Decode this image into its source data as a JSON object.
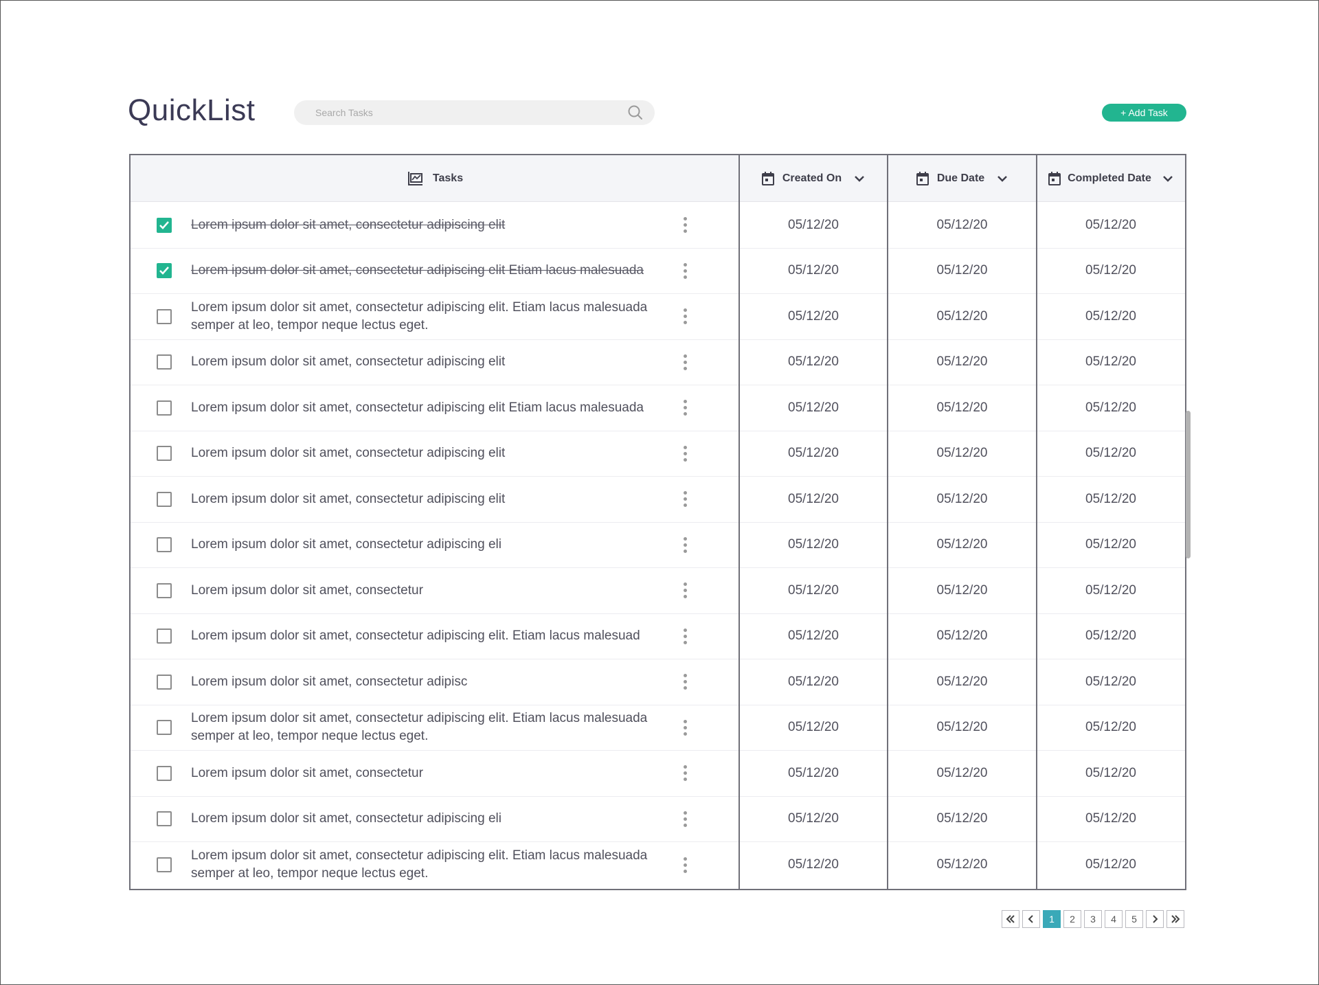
{
  "app": {
    "title": "QuickList"
  },
  "search": {
    "placeholder": "Search Tasks",
    "icon": "search-icon"
  },
  "toolbar": {
    "add_task_label": "+ Add Task"
  },
  "colors": {
    "accent": "#22b590",
    "pager_active": "#3aa9b8"
  },
  "table": {
    "headers": {
      "tasks": "Tasks",
      "created_on": "Created On",
      "due_date": "Due Date",
      "completed_date": "Completed Date"
    },
    "rows": [
      {
        "checked": true,
        "text": "Lorem ipsum dolor sit amet, consectetur adipiscing elit",
        "created": "05/12/20",
        "due": "05/12/20",
        "completed": "05/12/20"
      },
      {
        "checked": true,
        "text": "Lorem ipsum dolor sit amet, consectetur adipiscing elit Etiam lacus malesuada",
        "created": "05/12/20",
        "due": "05/12/20",
        "completed": "05/12/20"
      },
      {
        "checked": false,
        "text": "Lorem ipsum dolor sit amet, consectetur adipiscing elit. Etiam lacus malesuada semper at leo, tempor neque lectus eget.",
        "created": "05/12/20",
        "due": "05/12/20",
        "completed": "05/12/20"
      },
      {
        "checked": false,
        "text": "Lorem ipsum dolor sit amet, consectetur adipiscing elit",
        "created": "05/12/20",
        "due": "05/12/20",
        "completed": "05/12/20"
      },
      {
        "checked": false,
        "text": "Lorem ipsum dolor sit amet, consectetur adipiscing elit Etiam lacus malesuada",
        "created": "05/12/20",
        "due": "05/12/20",
        "completed": "05/12/20"
      },
      {
        "checked": false,
        "text": "Lorem ipsum dolor sit amet, consectetur adipiscing elit",
        "created": "05/12/20",
        "due": "05/12/20",
        "completed": "05/12/20"
      },
      {
        "checked": false,
        "text": "Lorem ipsum dolor sit amet, consectetur adipiscing elit",
        "created": "05/12/20",
        "due": "05/12/20",
        "completed": "05/12/20"
      },
      {
        "checked": false,
        "text": "Lorem ipsum dolor sit amet, consectetur adipiscing eli",
        "created": "05/12/20",
        "due": "05/12/20",
        "completed": "05/12/20"
      },
      {
        "checked": false,
        "text": "Lorem ipsum dolor sit amet, consectetur",
        "created": "05/12/20",
        "due": "05/12/20",
        "completed": "05/12/20"
      },
      {
        "checked": false,
        "text": "Lorem ipsum dolor sit amet, consectetur adipiscing elit. Etiam lacus malesuad",
        "created": "05/12/20",
        "due": "05/12/20",
        "completed": "05/12/20"
      },
      {
        "checked": false,
        "text": "Lorem ipsum dolor sit amet, consectetur adipisc",
        "created": "05/12/20",
        "due": "05/12/20",
        "completed": "05/12/20"
      },
      {
        "checked": false,
        "text": "Lorem ipsum dolor sit amet, consectetur adipiscing elit. Etiam lacus malesuada semper at leo, tempor neque lectus eget.",
        "created": "05/12/20",
        "due": "05/12/20",
        "completed": "05/12/20"
      },
      {
        "checked": false,
        "text": "Lorem ipsum dolor sit amet, consectetur",
        "created": "05/12/20",
        "due": "05/12/20",
        "completed": "05/12/20"
      },
      {
        "checked": false,
        "text": "Lorem ipsum dolor sit amet, consectetur adipiscing eli",
        "created": "05/12/20",
        "due": "05/12/20",
        "completed": "05/12/20"
      },
      {
        "checked": false,
        "text": "Lorem ipsum dolor sit amet, consectetur adipiscing elit. Etiam lacus malesuada semper at leo, tempor neque lectus eget.",
        "created": "05/12/20",
        "due": "05/12/20",
        "completed": "05/12/20"
      }
    ]
  },
  "pagination": {
    "first_icon": "double-chevron-left-icon",
    "prev_icon": "chevron-left-icon",
    "pages": [
      "1",
      "2",
      "3",
      "4",
      "5"
    ],
    "active_page": "1",
    "next_icon": "chevron-right-icon",
    "last_icon": "double-chevron-right-icon"
  }
}
